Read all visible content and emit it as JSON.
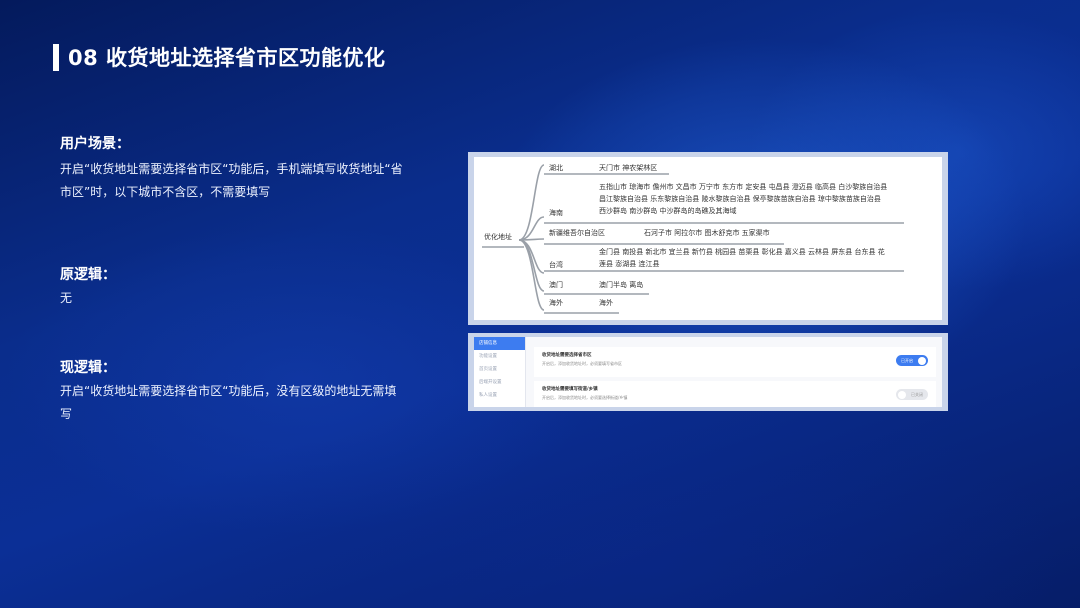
{
  "title": "08 收货地址选择省市区功能优化",
  "scenario": {
    "heading": "用户场景：",
    "body": "开启“收货地址需要选择省市区“功能后，手机端填写收货地址“省市区”时，以下城市不含区，不需要填写"
  },
  "old_logic": {
    "heading": "原逻辑：",
    "body": "无"
  },
  "new_logic": {
    "heading": "现逻辑：",
    "body": "开启“收货地址需要选择省市区“功能后，没有区级的地址无需填写"
  },
  "mindmap": {
    "root": "优化地址",
    "branches": [
      {
        "label": "湖北",
        "items": "天门市  神农架林区"
      },
      {
        "label": "海南",
        "items": "五指山市 琼海市 儋州市 文昌市 万宁市 东方市 定安县 屯昌县 澄迈县 临高县 白沙黎族自治县 昌江黎族自治县 乐东黎族自治县 陵水黎族自治县 保亭黎族苗族自治县 琼中黎族苗族自治县 西沙群岛 南沙群岛 中沙群岛的岛礁及其海域"
      },
      {
        "label": "新疆维吾尔自治区",
        "items": "石河子市 阿拉尔市 图木舒克市 五家渠市"
      },
      {
        "label": "台湾",
        "items": "金门县 南投县 新北市 宜兰县 新竹县 桃园县 苗栗县 彰化县 嘉义县 云林县 屏东县 台东县 花莲县 澎湖县 连江县"
      },
      {
        "label": "澳门",
        "items": "澳门半岛 离岛"
      },
      {
        "label": "海外",
        "items": "海外"
      }
    ]
  },
  "settings": {
    "sidebar": [
      "店铺信息",
      "功能设置",
      "首页设置",
      "后端开设置",
      "私人设置"
    ],
    "rows": [
      {
        "title": "收货地址需要选择省市区",
        "desc": "开启后，添加收货地址时，必须要填写省市区",
        "toggle": "已开启",
        "on": true
      },
      {
        "title": "收货地址需要填写街道/乡镇",
        "desc": "开启后，添加收货地址时，必须要选择街道/乡镇",
        "toggle": "已关闭",
        "on": false
      }
    ]
  },
  "colors": {
    "accent": "#3d7cf0",
    "background": "#0a2d8c"
  }
}
